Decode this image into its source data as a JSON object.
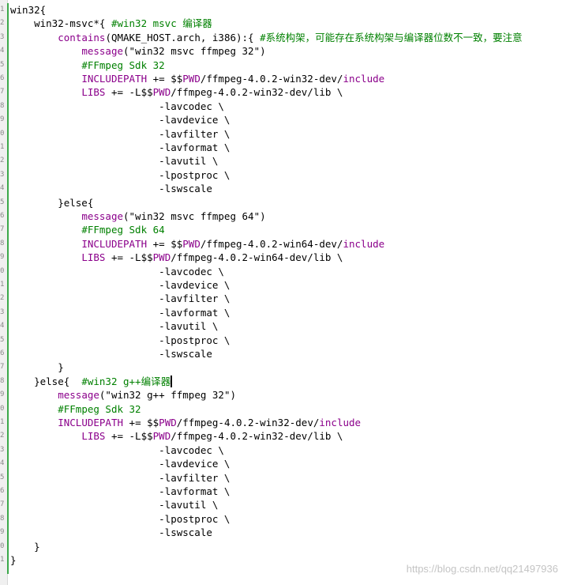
{
  "editor": {
    "line_numbers": [
      "1",
      "2",
      "3",
      "4",
      "5",
      "6",
      "7",
      "8",
      "9",
      "0",
      "1",
      "2",
      "3",
      "4",
      "5",
      "6",
      "7",
      "8",
      "9",
      "0",
      "1",
      "2",
      "3",
      "4",
      "5",
      "6",
      "7",
      "8",
      "9",
      "0",
      "1",
      "2",
      "3",
      "4",
      "5",
      "6",
      "7",
      "8",
      "9",
      "0",
      "1"
    ],
    "lines": [
      [
        {
          "t": "win32{",
          "c": "plain"
        }
      ],
      [
        {
          "t": "    win32-msvc*{ ",
          "c": "plain"
        },
        {
          "t": "#win32 msvc 编译器",
          "c": "comment"
        }
      ],
      [
        {
          "t": "        ",
          "c": "plain"
        },
        {
          "t": "contains",
          "c": "keyword"
        },
        {
          "t": "(QMAKE_HOST.arch, i386):{ ",
          "c": "plain"
        },
        {
          "t": "#系统构架，可能存在系统构架与编译器位数不一致，要注意",
          "c": "comment"
        }
      ],
      [
        {
          "t": "            ",
          "c": "plain"
        },
        {
          "t": "message",
          "c": "keyword"
        },
        {
          "t": "(\"win32 msvc ffmpeg 32\")",
          "c": "string"
        }
      ],
      [
        {
          "t": "            ",
          "c": "plain"
        },
        {
          "t": "#FFmpeg Sdk 32",
          "c": "comment"
        }
      ],
      [
        {
          "t": "            ",
          "c": "plain"
        },
        {
          "t": "INCLUDEPATH",
          "c": "variable"
        },
        {
          "t": " += $$",
          "c": "plain"
        },
        {
          "t": "PWD",
          "c": "variable"
        },
        {
          "t": "/ffmpeg-4.0.2-win32-dev/",
          "c": "plain"
        },
        {
          "t": "include",
          "c": "keyword"
        }
      ],
      [
        {
          "t": "            ",
          "c": "plain"
        },
        {
          "t": "LIBS",
          "c": "variable"
        },
        {
          "t": " += -L$$",
          "c": "plain"
        },
        {
          "t": "PWD",
          "c": "variable"
        },
        {
          "t": "/ffmpeg-4.0.2-win32-dev/lib \\",
          "c": "plain"
        }
      ],
      [
        {
          "t": "                         -lavcodec \\",
          "c": "plain"
        }
      ],
      [
        {
          "t": "                         -lavdevice \\",
          "c": "plain"
        }
      ],
      [
        {
          "t": "                         -lavfilter \\",
          "c": "plain"
        }
      ],
      [
        {
          "t": "                         -lavformat \\",
          "c": "plain"
        }
      ],
      [
        {
          "t": "                         -lavutil \\",
          "c": "plain"
        }
      ],
      [
        {
          "t": "                         -lpostproc \\",
          "c": "plain"
        }
      ],
      [
        {
          "t": "                         -lswscale",
          "c": "plain"
        }
      ],
      [
        {
          "t": "        }else{",
          "c": "plain"
        }
      ],
      [
        {
          "t": "            ",
          "c": "plain"
        },
        {
          "t": "message",
          "c": "keyword"
        },
        {
          "t": "(\"win32 msvc ffmpeg 64\")",
          "c": "string"
        }
      ],
      [
        {
          "t": "            ",
          "c": "plain"
        },
        {
          "t": "#FFmpeg Sdk 64",
          "c": "comment"
        }
      ],
      [
        {
          "t": "            ",
          "c": "plain"
        },
        {
          "t": "INCLUDEPATH",
          "c": "variable"
        },
        {
          "t": " += $$",
          "c": "plain"
        },
        {
          "t": "PWD",
          "c": "variable"
        },
        {
          "t": "/ffmpeg-4.0.2-win64-dev/",
          "c": "plain"
        },
        {
          "t": "include",
          "c": "keyword"
        }
      ],
      [
        {
          "t": "            ",
          "c": "plain"
        },
        {
          "t": "LIBS",
          "c": "variable"
        },
        {
          "t": " += -L$$",
          "c": "plain"
        },
        {
          "t": "PWD",
          "c": "variable"
        },
        {
          "t": "/ffmpeg-4.0.2-win64-dev/lib \\",
          "c": "plain"
        }
      ],
      [
        {
          "t": "                         -lavcodec \\",
          "c": "plain"
        }
      ],
      [
        {
          "t": "                         -lavdevice \\",
          "c": "plain"
        }
      ],
      [
        {
          "t": "                         -lavfilter \\",
          "c": "plain"
        }
      ],
      [
        {
          "t": "                         -lavformat \\",
          "c": "plain"
        }
      ],
      [
        {
          "t": "                         -lavutil \\",
          "c": "plain"
        }
      ],
      [
        {
          "t": "                         -lpostproc \\",
          "c": "plain"
        }
      ],
      [
        {
          "t": "                         -lswscale",
          "c": "plain"
        }
      ],
      [
        {
          "t": "        }",
          "c": "plain"
        }
      ],
      [
        {
          "t": "    }else{  ",
          "c": "plain"
        },
        {
          "t": "#win32 g++编译器",
          "c": "comment"
        },
        {
          "t": "",
          "c": "caret"
        }
      ],
      [
        {
          "t": "        ",
          "c": "plain"
        },
        {
          "t": "message",
          "c": "keyword"
        },
        {
          "t": "(\"win32 g++ ffmpeg 32\")",
          "c": "string"
        }
      ],
      [
        {
          "t": "        ",
          "c": "plain"
        },
        {
          "t": "#FFmpeg Sdk 32",
          "c": "comment"
        }
      ],
      [
        {
          "t": "        ",
          "c": "plain"
        },
        {
          "t": "INCLUDEPATH",
          "c": "variable"
        },
        {
          "t": " += $$",
          "c": "plain"
        },
        {
          "t": "PWD",
          "c": "variable"
        },
        {
          "t": "/ffmpeg-4.0.2-win32-dev/",
          "c": "plain"
        },
        {
          "t": "include",
          "c": "keyword"
        }
      ],
      [
        {
          "t": "            ",
          "c": "plain"
        },
        {
          "t": "LIBS",
          "c": "variable"
        },
        {
          "t": " += -L$$",
          "c": "plain"
        },
        {
          "t": "PWD",
          "c": "variable"
        },
        {
          "t": "/ffmpeg-4.0.2-win32-dev/lib \\",
          "c": "plain"
        }
      ],
      [
        {
          "t": "                         -lavcodec \\",
          "c": "plain"
        }
      ],
      [
        {
          "t": "                         -lavdevice \\",
          "c": "plain"
        }
      ],
      [
        {
          "t": "                         -lavfilter \\",
          "c": "plain"
        }
      ],
      [
        {
          "t": "                         -lavformat \\",
          "c": "plain"
        }
      ],
      [
        {
          "t": "                         -lavutil \\",
          "c": "plain"
        }
      ],
      [
        {
          "t": "                         -lpostproc \\",
          "c": "plain"
        }
      ],
      [
        {
          "t": "                         -lswscale",
          "c": "plain"
        }
      ],
      [
        {
          "t": "    }",
          "c": "plain"
        }
      ],
      [
        {
          "t": "}",
          "c": "plain"
        }
      ]
    ]
  },
  "watermark": "https://blog.csdn.net/qq21497936",
  "colors": {
    "background": "#ffffff",
    "keyword": "#8b008b",
    "comment": "#008000",
    "fold_bar": "#3ca84a",
    "gutter": "#f0f0f0"
  }
}
